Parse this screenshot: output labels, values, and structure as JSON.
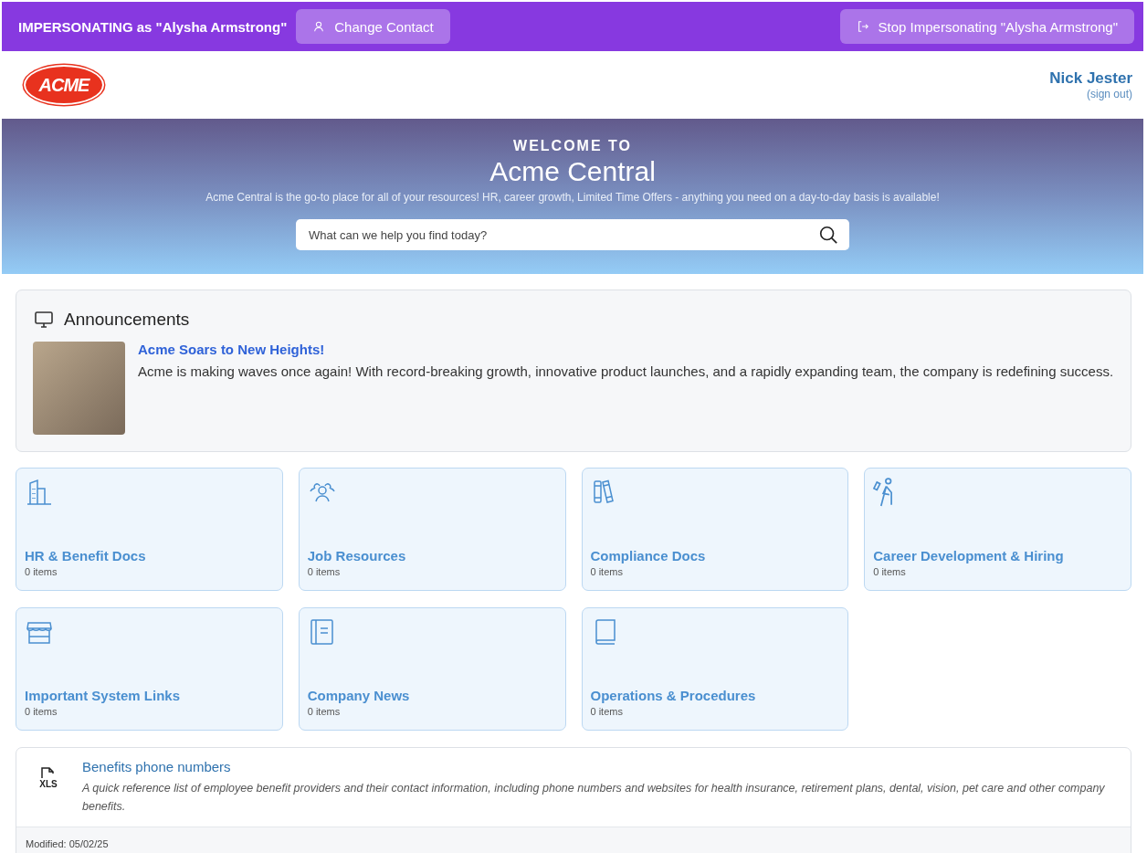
{
  "impersonation_bar": {
    "label": "IMPERSONATING as \"Alysha Armstrong\"",
    "change_button": "Change Contact",
    "stop_button": "Stop Impersonating \"Alysha Armstrong\""
  },
  "header": {
    "logo_text": "ACME",
    "user_name": "Nick Jester",
    "sign_out": "(sign out)"
  },
  "hero": {
    "eyebrow": "WELCOME TO",
    "title": "Acme Central",
    "subtitle": "Acme Central is the go-to place for all of your resources! HR, career growth, Limited Time Offers - anything you need on a day-to-day basis is available!",
    "search_placeholder": "What can we help you find today?"
  },
  "announcements": {
    "heading": "Announcements",
    "items": [
      {
        "title": "Acme Soars to New Heights!",
        "body": "Acme is making waves once again! With record-breaking growth, innovative product launches, and a rapidly expanding team, the company is redefining success."
      }
    ]
  },
  "categories": [
    {
      "title": "HR & Benefit Docs",
      "count": "0 items"
    },
    {
      "title": "Job Resources",
      "count": "0 items"
    },
    {
      "title": "Compliance Docs",
      "count": "0 items"
    },
    {
      "title": "Career Development & Hiring",
      "count": "0 items"
    },
    {
      "title": "Important System Links",
      "count": "0 items"
    },
    {
      "title": "Company News",
      "count": "0 items"
    },
    {
      "title": "Operations & Procedures",
      "count": "0 items"
    }
  ],
  "documents": [
    {
      "file_type": "XLS",
      "title": "Benefits phone numbers",
      "description": "A quick reference list of employee benefit providers and their contact information, including phone numbers and websites for health insurance, retirement plans, dental, vision, pet care and other company benefits.",
      "modified": "Modified: 05/02/25"
    }
  ]
}
